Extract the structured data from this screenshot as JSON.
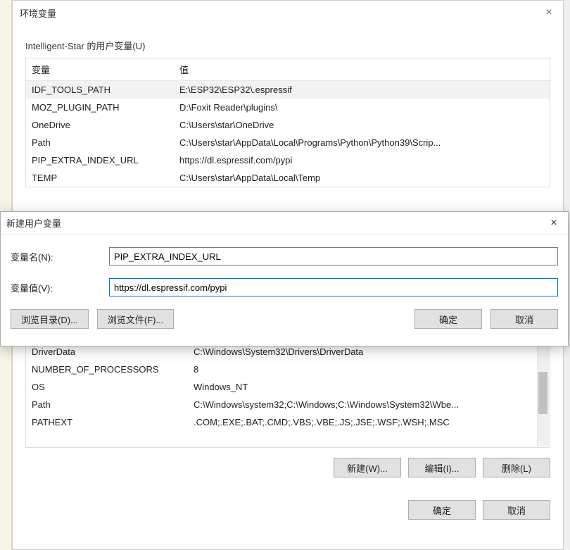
{
  "env_dialog": {
    "title": "环境变量",
    "user_group_label": "Intelligent-Star 的用户变量(U)",
    "col_var": "变量",
    "col_val": "值",
    "user_vars": [
      {
        "name": "IDF_TOOLS_PATH",
        "value": "E:\\ESP32\\ESP32\\.espressif",
        "selected": true
      },
      {
        "name": "MOZ_PLUGIN_PATH",
        "value": "D:\\Foxit Reader\\plugins\\"
      },
      {
        "name": "OneDrive",
        "value": "C:\\Users\\star\\OneDrive"
      },
      {
        "name": "Path",
        "value": "C:\\Users\\star\\AppData\\Local\\Programs\\Python\\Python39\\Scrip..."
      },
      {
        "name": "PIP_EXTRA_INDEX_URL",
        "value": "https://dl.espressif.com/pypi"
      },
      {
        "name": "TEMP",
        "value": "C:\\Users\\star\\AppData\\Local\\Temp"
      }
    ],
    "system_vars": [
      {
        "name": "DriverData",
        "value": "C:\\Windows\\System32\\Drivers\\DriverData"
      },
      {
        "name": "NUMBER_OF_PROCESSORS",
        "value": "8"
      },
      {
        "name": "OS",
        "value": "Windows_NT"
      },
      {
        "name": "Path",
        "value": "C:\\Windows\\system32;C:\\Windows;C:\\Windows\\System32\\Wbe..."
      },
      {
        "name": "PATHEXT",
        "value": ".COM;.EXE;.BAT;.CMD;.VBS;.VBE;.JS;.JSE;.WSF;.WSH;.MSC"
      }
    ],
    "btn_new": "新建(W)...",
    "btn_edit": "编辑(I)...",
    "btn_delete": "删除(L)",
    "btn_ok": "确定",
    "btn_cancel": "取消"
  },
  "new_var_dialog": {
    "title": "新建用户变量",
    "label_name": "变量名(N):",
    "label_value": "变量值(V):",
    "value_name": "PIP_EXTRA_INDEX_URL",
    "value_value": "https://dl.espressif.com/pypi",
    "btn_browse_dir": "浏览目录(D)...",
    "btn_browse_file": "浏览文件(F)...",
    "btn_ok": "确定",
    "btn_cancel": "取消"
  }
}
